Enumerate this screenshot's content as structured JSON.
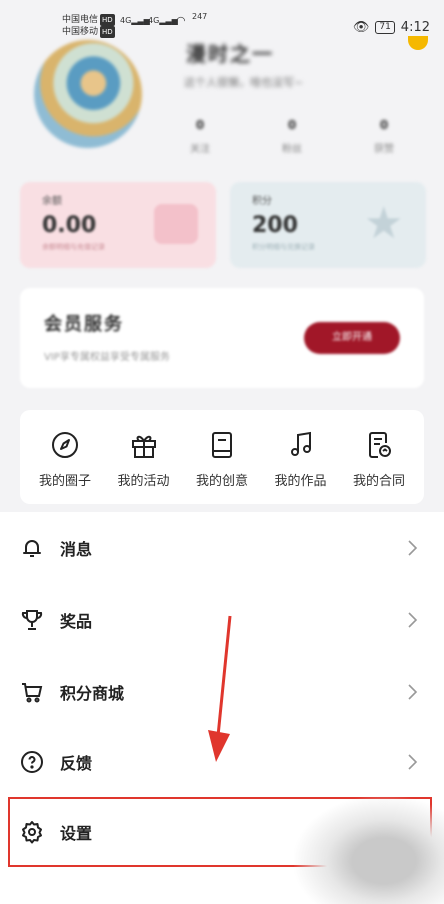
{
  "status_bar": {
    "carrier1": "中国电信",
    "carrier2": "中国移动",
    "hd": "HD",
    "net1": "4G",
    "net2": "4G",
    "speed": "247",
    "battery": "71",
    "time": "4:12"
  },
  "profile": {
    "username": "漫时之一",
    "bio": "这个人很懒，啥也没写~",
    "stats": [
      {
        "value": "0",
        "label": "关注"
      },
      {
        "value": "0",
        "label": "粉丝"
      },
      {
        "value": "0",
        "label": "获赞"
      }
    ]
  },
  "cards": {
    "balance": {
      "label": "余额",
      "value": "0.00",
      "sub": "余额明细与充值记录"
    },
    "points": {
      "label": "积分",
      "value": "200",
      "sub": "积分明细与兑换记录"
    }
  },
  "vip": {
    "title": "会员服务",
    "subtitle": "VIP享专属权益享受专属服务",
    "button": "立即开通"
  },
  "quick_menu": [
    {
      "label": "我的圈子",
      "icon": "compass-icon"
    },
    {
      "label": "我的活动",
      "icon": "gift-icon"
    },
    {
      "label": "我的创意",
      "icon": "book-icon"
    },
    {
      "label": "我的作品",
      "icon": "music-note-icon"
    },
    {
      "label": "我的合同",
      "icon": "contract-icon"
    }
  ],
  "menu_list": [
    {
      "label": "消息",
      "icon": "bell-icon"
    },
    {
      "label": "奖品",
      "icon": "trophy-icon"
    },
    {
      "label": "积分商城",
      "icon": "cart-icon"
    },
    {
      "label": "反馈",
      "icon": "help-icon"
    },
    {
      "label": "设置",
      "icon": "gear-icon"
    }
  ],
  "colors": {
    "accent": "#a11728",
    "highlight": "#e0362d"
  }
}
